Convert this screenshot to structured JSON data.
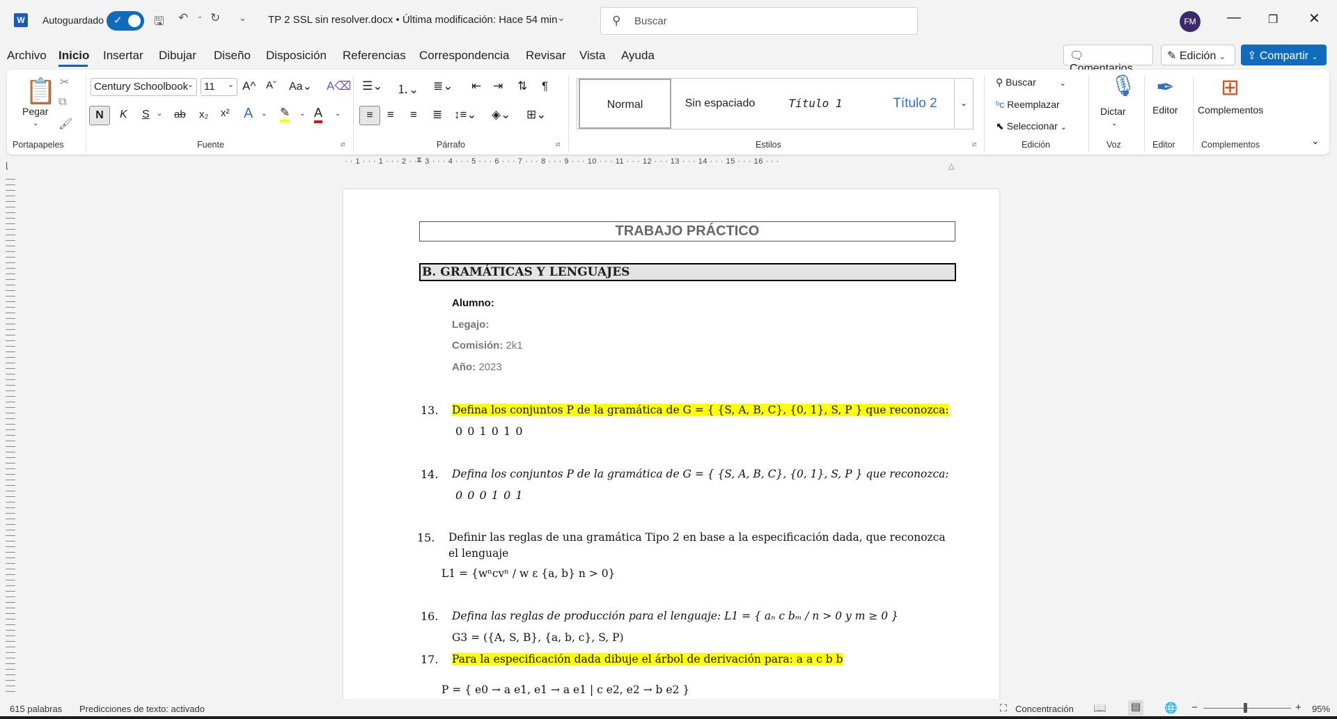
{
  "titlebar": {
    "autosave_label": "Autoguardado",
    "doc_title": "TP 2 SSL sin resolver.docx • Última modificación: Hace 54 min",
    "search_placeholder": "Buscar",
    "avatar_initials": "FM"
  },
  "menu": {
    "items": [
      "Archivo",
      "Inicio",
      "Insertar",
      "Dibujar",
      "Diseño",
      "Disposición",
      "Referencias",
      "Correspondencia",
      "Revisar",
      "Vista",
      "Ayuda"
    ],
    "comments": "Comentarios",
    "editing": "Edición",
    "share": "Compartir"
  },
  "ribbon": {
    "paste": "Pegar",
    "font_name": "Century Schoolbook",
    "font_size": "11",
    "styles": [
      "Normal",
      "Sin espaciado",
      "Título 1",
      "Título 2"
    ],
    "find": "Buscar",
    "replace": "Reemplazar",
    "select": "Seleccionar",
    "dictate": "Dictar",
    "editor": "Editor",
    "addins": "Complementos",
    "groups": {
      "clipboard": "Portapapeles",
      "font": "Fuente",
      "paragraph": "Párrafo",
      "styles": "Estilos",
      "editing": "Edición",
      "voice": "Voz",
      "editor": "Editor",
      "addins": "Complementos"
    },
    "bold": "N",
    "italic": "K",
    "underline": "S"
  },
  "ruler": "· · 1 · · · 1 · · · 2 · · · 3 · · · 4 · · · 5 · · · 6 · · · 7 · · · 8 · · · 9 · · · 10 · · · 11 · · · 12 · · · 13 · · · 14 · · · 15 · · · 16 · · ·",
  "document": {
    "title": "TRABAJO PRÁCTICO",
    "section": "B. GRAMÁTICAS Y LENGUAJES",
    "alumno_label": "Alumno:",
    "legajo_label": "Legajo:",
    "comision_label": "Comisión:",
    "comision_value": "2k1",
    "anio_label": "Año:",
    "anio_value": "2023",
    "items": [
      {
        "num": "13.",
        "text": "Defina los conjuntos P de la gramática de G = { {S, A, B, C}, {0, 1}, S, P } que reconozca:",
        "sub": "0 0 1 0 1 0"
      },
      {
        "num": "14.",
        "text": "Defina los conjuntos P de la gramática de G = { {S, A, B, C}, {0, 1}, S, P } que reconozca:",
        "sub": "0 0 0 1 0 1"
      },
      {
        "num": "15.",
        "text": "Definir las reglas de una gramática Tipo 2 en base a la especificación dada, que reconozca",
        "text2": "el lenguaje",
        "sub": "L1 = {wⁿcvⁿ / w ε {a, b} n > 0}"
      },
      {
        "num": "16.",
        "text": "Defina las reglas de producción para el lenguaje: L1 = { aₙ c bₘ / n > 0  y  m ≥ 0 }",
        "sub": "G3 = ({A, S, B}, {a, b, c}, S, P)"
      },
      {
        "num": "17.",
        "text": "Para la especificación dada dibuje el árbol de derivación para: a a c b b",
        "sub": "P = { e0 → a e1, e1 → a e1  |  c e2, e2 → b e2  }"
      }
    ]
  },
  "status": {
    "words": "615 palabras",
    "predictions": "Predicciones de texto: activado",
    "focus": "Concentración",
    "zoom": "95%"
  }
}
